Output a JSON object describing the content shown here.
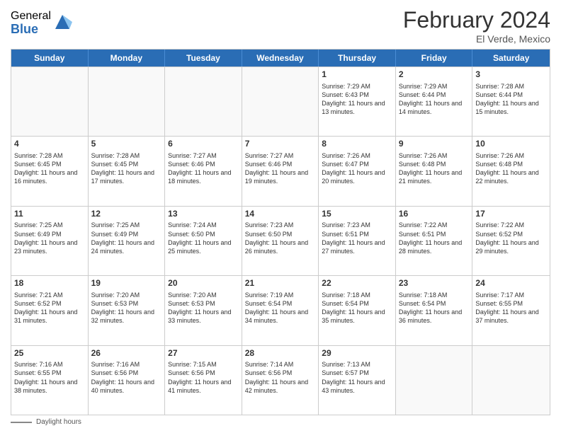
{
  "logo": {
    "general": "General",
    "blue": "Blue"
  },
  "title": "February 2024",
  "location": "El Verde, Mexico",
  "days_of_week": [
    "Sunday",
    "Monday",
    "Tuesday",
    "Wednesday",
    "Thursday",
    "Friday",
    "Saturday"
  ],
  "weeks": [
    [
      {
        "day": "",
        "empty": true
      },
      {
        "day": "",
        "empty": true
      },
      {
        "day": "",
        "empty": true
      },
      {
        "day": "",
        "empty": true
      },
      {
        "day": "1",
        "sunrise": "7:29 AM",
        "sunset": "6:43 PM",
        "daylight": "11 hours and 13 minutes."
      },
      {
        "day": "2",
        "sunrise": "7:29 AM",
        "sunset": "6:44 PM",
        "daylight": "11 hours and 14 minutes."
      },
      {
        "day": "3",
        "sunrise": "7:28 AM",
        "sunset": "6:44 PM",
        "daylight": "11 hours and 15 minutes."
      }
    ],
    [
      {
        "day": "4",
        "sunrise": "7:28 AM",
        "sunset": "6:45 PM",
        "daylight": "11 hours and 16 minutes."
      },
      {
        "day": "5",
        "sunrise": "7:28 AM",
        "sunset": "6:45 PM",
        "daylight": "11 hours and 17 minutes."
      },
      {
        "day": "6",
        "sunrise": "7:27 AM",
        "sunset": "6:46 PM",
        "daylight": "11 hours and 18 minutes."
      },
      {
        "day": "7",
        "sunrise": "7:27 AM",
        "sunset": "6:46 PM",
        "daylight": "11 hours and 19 minutes."
      },
      {
        "day": "8",
        "sunrise": "7:26 AM",
        "sunset": "6:47 PM",
        "daylight": "11 hours and 20 minutes."
      },
      {
        "day": "9",
        "sunrise": "7:26 AM",
        "sunset": "6:48 PM",
        "daylight": "11 hours and 21 minutes."
      },
      {
        "day": "10",
        "sunrise": "7:26 AM",
        "sunset": "6:48 PM",
        "daylight": "11 hours and 22 minutes."
      }
    ],
    [
      {
        "day": "11",
        "sunrise": "7:25 AM",
        "sunset": "6:49 PM",
        "daylight": "11 hours and 23 minutes."
      },
      {
        "day": "12",
        "sunrise": "7:25 AM",
        "sunset": "6:49 PM",
        "daylight": "11 hours and 24 minutes."
      },
      {
        "day": "13",
        "sunrise": "7:24 AM",
        "sunset": "6:50 PM",
        "daylight": "11 hours and 25 minutes."
      },
      {
        "day": "14",
        "sunrise": "7:23 AM",
        "sunset": "6:50 PM",
        "daylight": "11 hours and 26 minutes."
      },
      {
        "day": "15",
        "sunrise": "7:23 AM",
        "sunset": "6:51 PM",
        "daylight": "11 hours and 27 minutes."
      },
      {
        "day": "16",
        "sunrise": "7:22 AM",
        "sunset": "6:51 PM",
        "daylight": "11 hours and 28 minutes."
      },
      {
        "day": "17",
        "sunrise": "7:22 AM",
        "sunset": "6:52 PM",
        "daylight": "11 hours and 29 minutes."
      }
    ],
    [
      {
        "day": "18",
        "sunrise": "7:21 AM",
        "sunset": "6:52 PM",
        "daylight": "11 hours and 31 minutes."
      },
      {
        "day": "19",
        "sunrise": "7:20 AM",
        "sunset": "6:53 PM",
        "daylight": "11 hours and 32 minutes."
      },
      {
        "day": "20",
        "sunrise": "7:20 AM",
        "sunset": "6:53 PM",
        "daylight": "11 hours and 33 minutes."
      },
      {
        "day": "21",
        "sunrise": "7:19 AM",
        "sunset": "6:54 PM",
        "daylight": "11 hours and 34 minutes."
      },
      {
        "day": "22",
        "sunrise": "7:18 AM",
        "sunset": "6:54 PM",
        "daylight": "11 hours and 35 minutes."
      },
      {
        "day": "23",
        "sunrise": "7:18 AM",
        "sunset": "6:54 PM",
        "daylight": "11 hours and 36 minutes."
      },
      {
        "day": "24",
        "sunrise": "7:17 AM",
        "sunset": "6:55 PM",
        "daylight": "11 hours and 37 minutes."
      }
    ],
    [
      {
        "day": "25",
        "sunrise": "7:16 AM",
        "sunset": "6:55 PM",
        "daylight": "11 hours and 38 minutes."
      },
      {
        "day": "26",
        "sunrise": "7:16 AM",
        "sunset": "6:56 PM",
        "daylight": "11 hours and 40 minutes."
      },
      {
        "day": "27",
        "sunrise": "7:15 AM",
        "sunset": "6:56 PM",
        "daylight": "11 hours and 41 minutes."
      },
      {
        "day": "28",
        "sunrise": "7:14 AM",
        "sunset": "6:56 PM",
        "daylight": "11 hours and 42 minutes."
      },
      {
        "day": "29",
        "sunrise": "7:13 AM",
        "sunset": "6:57 PM",
        "daylight": "11 hours and 43 minutes."
      },
      {
        "day": "",
        "empty": true
      },
      {
        "day": "",
        "empty": true
      }
    ]
  ],
  "footer": {
    "note": "Daylight hours"
  }
}
